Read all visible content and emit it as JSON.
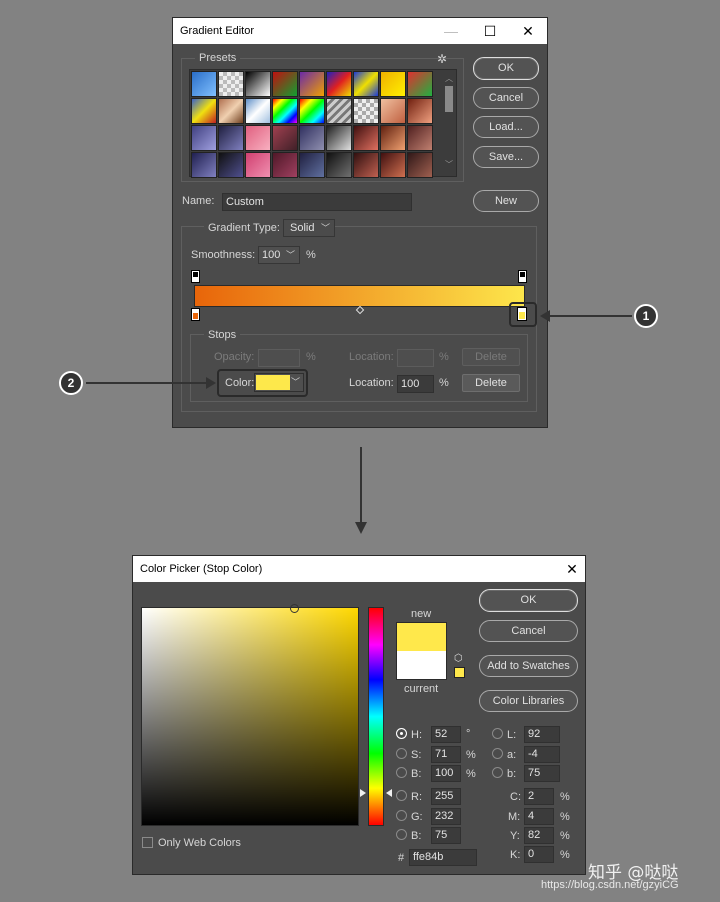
{
  "gradient_editor": {
    "title": "Gradient Editor",
    "window_controls": [
      "—",
      "☐",
      "✕"
    ],
    "presets_label": "Presets",
    "buttons": {
      "ok": "OK",
      "cancel": "Cancel",
      "load": "Load...",
      "save": "Save...",
      "new": "New"
    },
    "name_label": "Name:",
    "name_value": "Custom",
    "gradient_type_label": "Gradient Type:",
    "gradient_type_value": "Solid",
    "smoothness_label": "Smoothness:",
    "smoothness_value": "100",
    "smoothness_unit": "%",
    "gradient_colors": [
      "#e8650a",
      "#fde64b"
    ],
    "stops_title": "Stops",
    "opacity_label": "Opacity:",
    "opacity_unit": "%",
    "location_label": "Location:",
    "location_unit": "%",
    "delete_label": "Delete",
    "color_label": "Color:",
    "color_swatch": "#fde84b",
    "color_location_value": "100",
    "preset_swatches": [
      "linear-gradient(135deg,#2a6ec8,#80c0ff)",
      "repeating-conic-gradient(#bbb 0 25%,#eee 0 50%) 0 0/8px 8px",
      "linear-gradient(135deg,#000,#fff)",
      "linear-gradient(135deg,#c01010,#10a030)",
      "linear-gradient(135deg,#6a2aa8,#f0a000)",
      "linear-gradient(135deg,#2020c0,#e02020,#f0e000)",
      "linear-gradient(135deg,#1a3ad8,#f0e000,#1a3ad8)",
      "linear-gradient(135deg,#f0b000,#fff000)",
      "linear-gradient(135deg,#e03030,#20b040)",
      "linear-gradient(135deg,#3a62c8,#f0e010,#c02020)",
      "linear-gradient(135deg,#b07050,#f0d0b0,#704020)",
      "linear-gradient(135deg,#6090c8,#fff,#a0c0e0)",
      "linear-gradient(135deg,#ff0000,#ffff00,#00ff00,#00ffff,#0000ff,#ff00ff)",
      "linear-gradient(135deg,#f00,#ff0,#0f0,#0ff,#00f)",
      "repeating-linear-gradient(135deg,#ccc 0 3px,#777 3px 6px)",
      "repeating-conic-gradient(#aaa 0 25%,#eee 0 50%) 0 0/8px 8px",
      "linear-gradient(135deg,#f0c0a0,#c06040)",
      "linear-gradient(135deg,#702010,#f0a080)",
      "linear-gradient(135deg,#404080,#a0a0e0)",
      "linear-gradient(135deg,#202040,#8080c0)",
      "linear-gradient(135deg,#e06080,#f8b0c0)",
      "linear-gradient(135deg,#a04050,#402028)",
      "linear-gradient(135deg,#303060,#9090b0)",
      "linear-gradient(135deg,#202020,#e0e0e0)",
      "linear-gradient(135deg,#401010,#e07060)",
      "linear-gradient(135deg,#602010,#f0a070)",
      "linear-gradient(135deg,#502020,#c08070)",
      "linear-gradient(135deg,#202050,#8080c0)",
      "linear-gradient(135deg,#101010,#505090)",
      "linear-gradient(135deg,#d04070,#f090b0)",
      "linear-gradient(135deg,#501828,#a04060)",
      "linear-gradient(135deg,#202040,#6070a0)",
      "linear-gradient(135deg,#101010,#707070)",
      "linear-gradient(135deg,#301010,#c06050)",
      "linear-gradient(135deg,#401010,#d07050)",
      "linear-gradient(135deg,#301818,#a06050)"
    ]
  },
  "color_picker": {
    "title": "Color Picker (Stop Color)",
    "close": "✕",
    "hue_color": "#ffd800",
    "new_label": "new",
    "current_label": "current",
    "new_color": "#ffe84b",
    "current_color": "#ffffff",
    "buttons": {
      "ok": "OK",
      "cancel": "Cancel",
      "add_swatches": "Add to Swatches",
      "color_libraries": "Color Libraries"
    },
    "only_web_colors": "Only Web Colors",
    "fields": {
      "H": {
        "label": "H:",
        "value": "52",
        "unit": "°"
      },
      "S": {
        "label": "S:",
        "value": "71",
        "unit": "%"
      },
      "B": {
        "label": "B:",
        "value": "100",
        "unit": "%"
      },
      "R": {
        "label": "R:",
        "value": "255"
      },
      "G": {
        "label": "G:",
        "value": "232"
      },
      "Bl": {
        "label": "B:",
        "value": "75"
      },
      "L": {
        "label": "L:",
        "value": "92"
      },
      "a": {
        "label": "a:",
        "value": "-4"
      },
      "b": {
        "label": "b:",
        "value": "75"
      },
      "C": {
        "label": "C:",
        "value": "2",
        "unit": "%"
      },
      "M": {
        "label": "M:",
        "value": "4",
        "unit": "%"
      },
      "Y": {
        "label": "Y:",
        "value": "82",
        "unit": "%"
      },
      "K": {
        "label": "K:",
        "value": "0",
        "unit": "%"
      }
    },
    "hex_label": "#",
    "hex_value": "ffe84b"
  },
  "callouts": {
    "one": "1",
    "two": "2"
  },
  "watermark": {
    "brand": "知乎 @哒哒",
    "url": "https://blog.csdn.net/gzyiCG"
  }
}
